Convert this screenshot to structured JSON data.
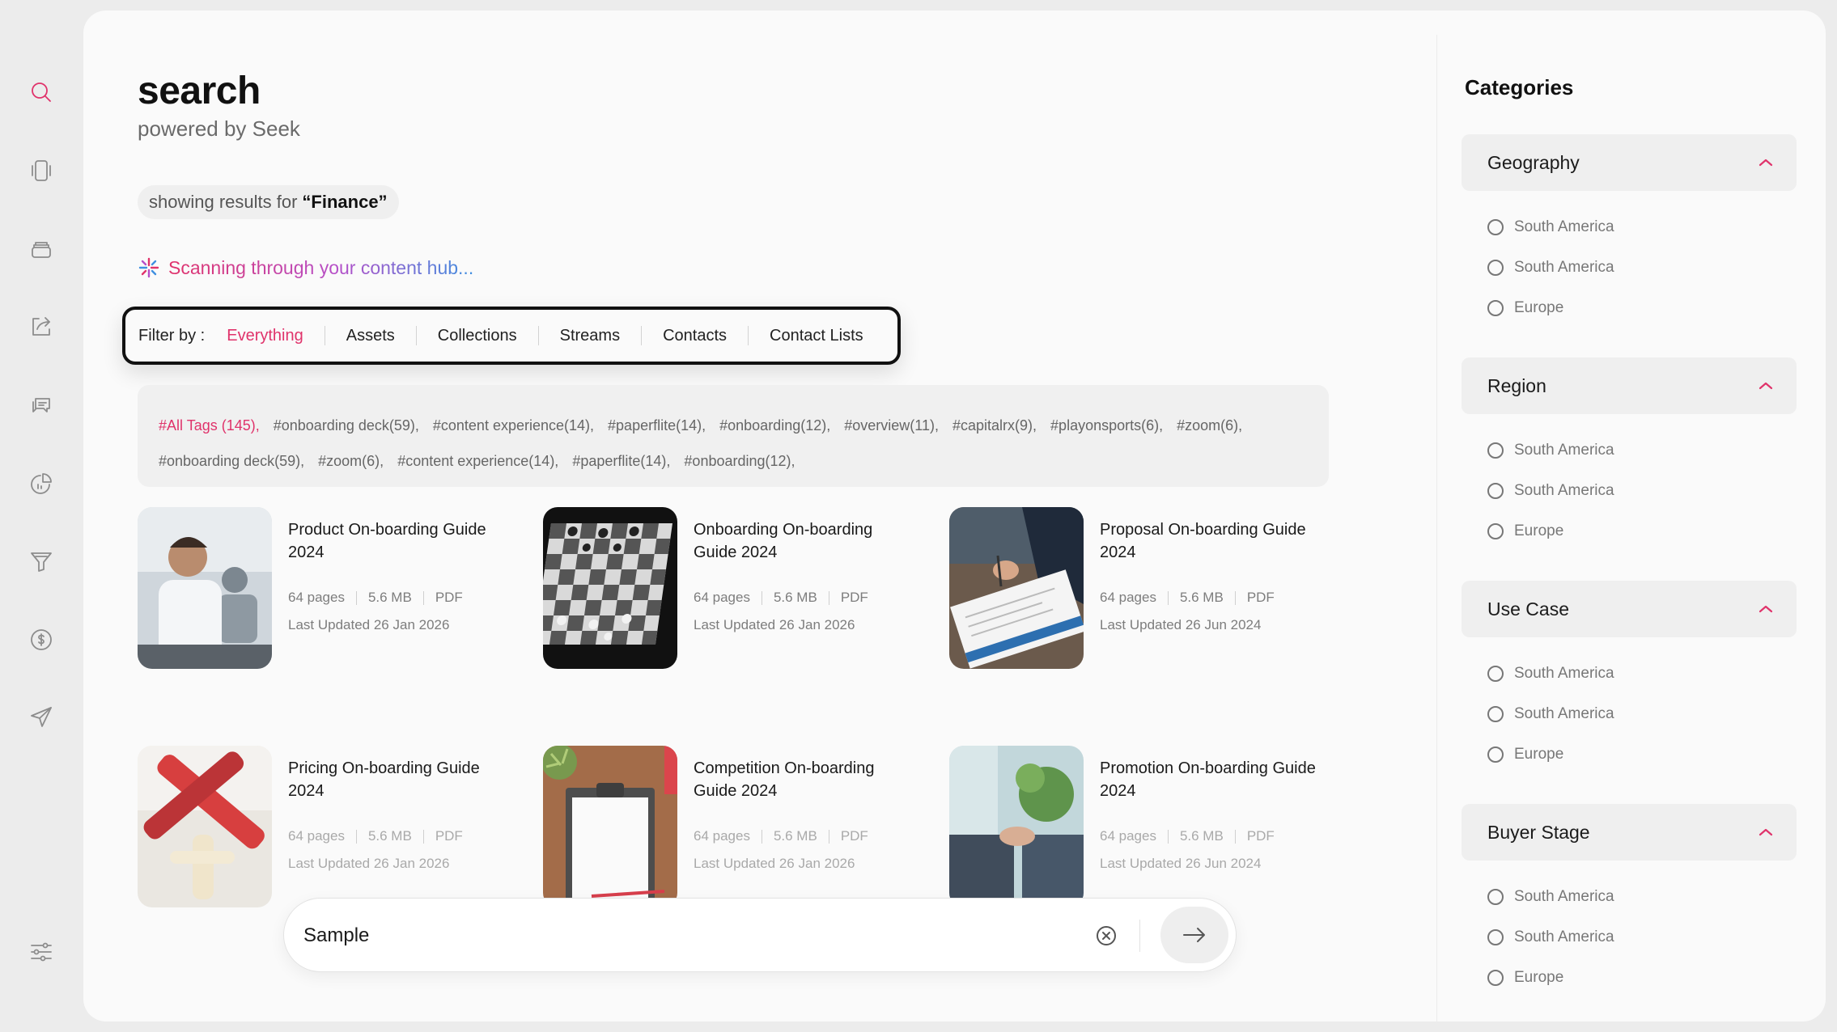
{
  "sidebar": {
    "icons": [
      {
        "name": "search-icon",
        "active": true
      },
      {
        "name": "mobile-icon",
        "active": false
      },
      {
        "name": "stack-icon",
        "active": false
      },
      {
        "name": "share-icon",
        "active": false
      },
      {
        "name": "chat-icon",
        "active": false
      },
      {
        "name": "analytics-icon",
        "active": false
      },
      {
        "name": "funnel-icon",
        "active": false
      },
      {
        "name": "dollar-icon",
        "active": false
      },
      {
        "name": "send-icon",
        "active": false
      },
      {
        "name": "sliders-icon",
        "active": false
      }
    ]
  },
  "header": {
    "title": "search",
    "subtitle": "powered by Seek",
    "results_prefix": "showing results for",
    "results_query": "“Finance”",
    "scanning_text": "Scanning through your content hub..."
  },
  "filter": {
    "label": "Filter by :",
    "items": [
      "Everything",
      "Assets",
      "Collections",
      "Streams",
      "Contacts",
      "Contact Lists"
    ],
    "active": "Everything"
  },
  "tags": {
    "items": [
      "#All Tags (145),",
      "#onboarding deck(59),",
      "#content experience(14),",
      "#paperflite(14),",
      "#onboarding(12),",
      "#overview(11),",
      "#capitalrx(9),",
      "#playonsports(6),",
      "#zoom(6),",
      "#onboarding deck(59),",
      "#zoom(6),",
      "#content experience(14),",
      "#paperflite(14),",
      "#onboarding(12),"
    ]
  },
  "results": [
    {
      "title": "Product On-boarding Guide 2024",
      "pages": "64 pages",
      "size": "5.6 MB",
      "type": "PDF",
      "updated": "Last Updated 26 Jan 2026"
    },
    {
      "title": "Onboarding On-boarding Guide 2024",
      "pages": "64 pages",
      "size": "5.6 MB",
      "type": "PDF",
      "updated": "Last Updated 26 Jan 2026"
    },
    {
      "title": "Proposal On-boarding Guide 2024",
      "pages": "64 pages",
      "size": "5.6 MB",
      "type": "PDF",
      "updated": "Last Updated 26 Jun 2024"
    },
    {
      "title": "Pricing On-boarding Guide 2024",
      "pages": "64 pages",
      "size": "5.6 MB",
      "type": "PDF",
      "updated": "Last Updated 26 Jan 2026"
    },
    {
      "title": "Competition On-boarding Guide 2024",
      "pages": "64 pages",
      "size": "5.6 MB",
      "type": "PDF",
      "updated": "Last Updated 26 Jan 2026"
    },
    {
      "title": "Promotion On-boarding Guide 2024",
      "pages": "64 pages",
      "size": "5.6 MB",
      "type": "PDF",
      "updated": "Last Updated 26 Jun 2024"
    }
  ],
  "search": {
    "value": "Sample"
  },
  "categories": {
    "title": "Categories",
    "groups": [
      {
        "label": "Geography",
        "options": [
          "South America",
          "South America",
          "Europe"
        ]
      },
      {
        "label": "Region",
        "options": [
          "South America",
          "South America",
          "Europe"
        ]
      },
      {
        "label": "Use Case",
        "options": [
          "South America",
          "South America",
          "Europe"
        ]
      },
      {
        "label": "Buyer Stage",
        "options": [
          "South America",
          "South America",
          "Europe"
        ]
      }
    ]
  },
  "colors": {
    "accent": "#e0336b",
    "background": "#fafafa",
    "panel": "#efefef"
  }
}
